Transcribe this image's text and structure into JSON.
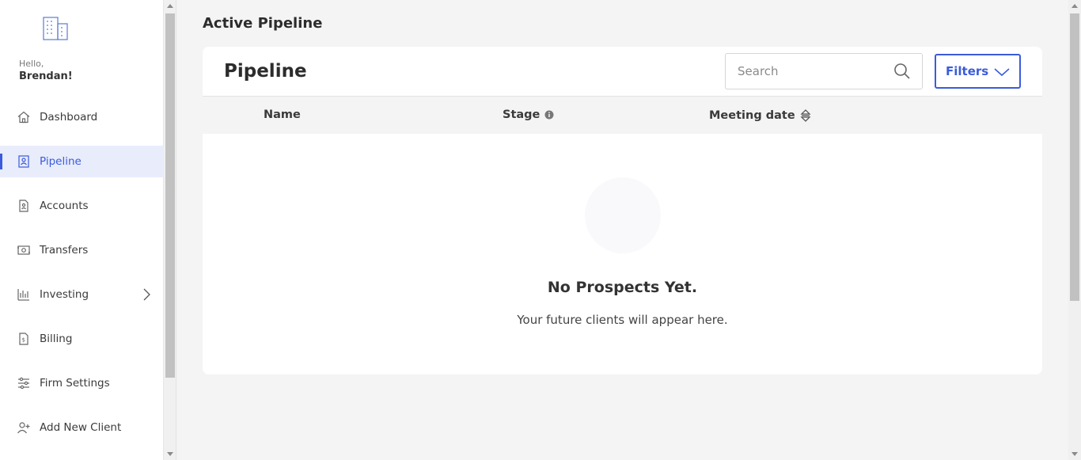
{
  "sidebar": {
    "greeting": "Hello,",
    "username": "Brendan!",
    "items": [
      {
        "label": "Dashboard",
        "icon": "home-icon"
      },
      {
        "label": "Pipeline",
        "icon": "id-badge-icon",
        "active": true
      },
      {
        "label": "Accounts",
        "icon": "document-person-icon"
      },
      {
        "label": "Transfers",
        "icon": "money-transfer-icon"
      },
      {
        "label": "Investing",
        "icon": "chart-bars-icon",
        "has_submenu": true
      },
      {
        "label": "Billing",
        "icon": "invoice-dollar-icon"
      },
      {
        "label": "Firm Settings",
        "icon": "sliders-icon"
      },
      {
        "label": "Add New Client",
        "icon": "user-plus-icon"
      }
    ]
  },
  "main": {
    "page_title": "Active Pipeline",
    "card": {
      "title": "Pipeline",
      "search": {
        "placeholder": "Search",
        "value": ""
      },
      "filters_label": "Filters",
      "columns": [
        "Name",
        "Stage",
        "Meeting date"
      ],
      "empty": {
        "title": "No Prospects Yet.",
        "subtitle": "Your future clients will appear here."
      }
    }
  },
  "colors": {
    "accent": "#3b5bdb",
    "active_bg": "#e8ecfb",
    "page_bg": "#f4f4f4"
  }
}
